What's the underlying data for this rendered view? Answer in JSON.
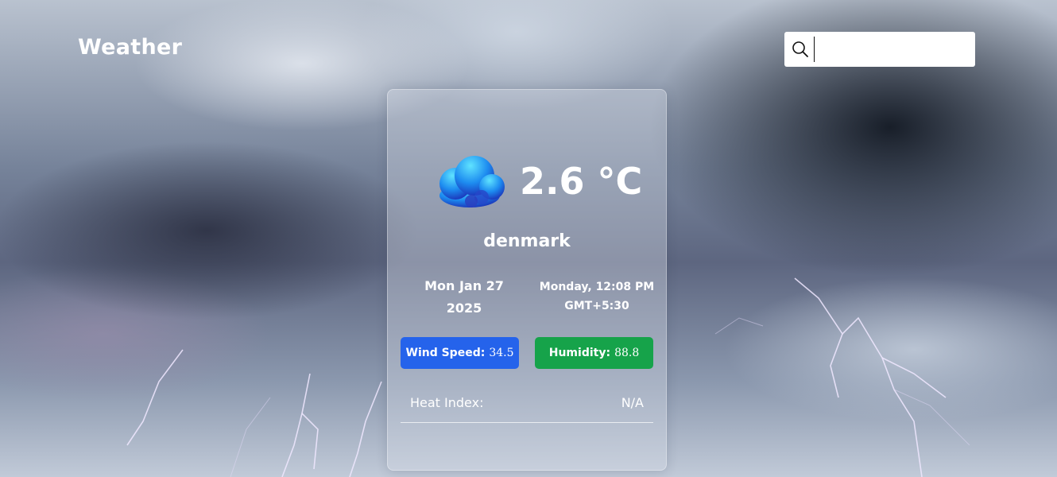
{
  "header": {
    "title": "Weather"
  },
  "search": {
    "placeholder": "",
    "value": "",
    "icon": "search-icon"
  },
  "current": {
    "condition_icon": "cloud-icon",
    "temperature": "2.6 °C",
    "city": "denmark",
    "date_line1": "Mon Jan 27",
    "date_line2": "2025",
    "time_line1": "Monday, 12:08 PM",
    "time_line2": "GMT+5:30",
    "wind_label": "Wind Speed:",
    "wind_value": "34.5",
    "humidity_label": "Humidity:",
    "humidity_value": "88.8",
    "heat_index_label": "Heat Index:",
    "heat_index_value": "N/A"
  },
  "colors": {
    "wind_badge": "#2563eb",
    "humidity_badge": "#16a34a",
    "card_background": "rgba(215,222,232,0.38)"
  }
}
